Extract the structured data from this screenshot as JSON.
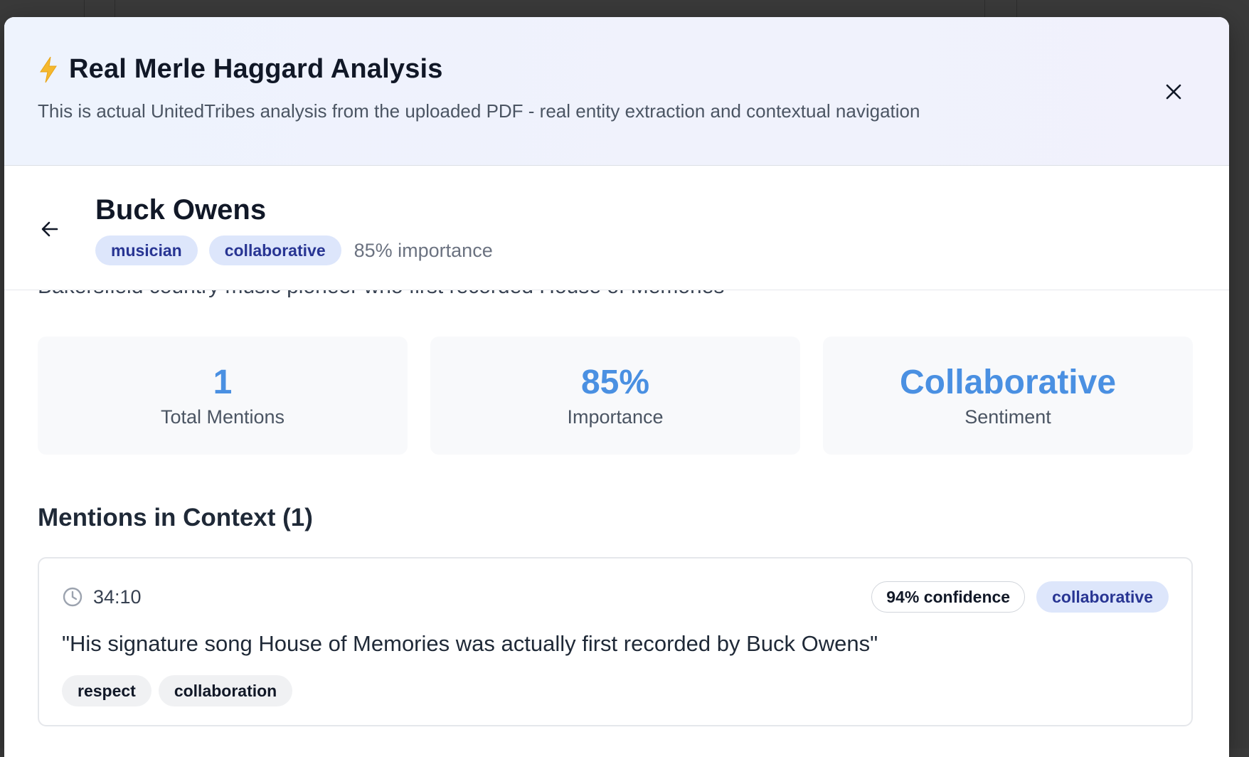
{
  "modal": {
    "title": "Real Merle Haggard Analysis",
    "subtitle": "This is actual UnitedTribes analysis from the uploaded PDF - real entity extraction and contextual navigation",
    "title_icon": "lightning-bolt-icon",
    "close_icon": "close-icon"
  },
  "entity": {
    "name": "Buck Owens",
    "type_tag": "musician",
    "sentiment_tag": "collaborative",
    "importance_text": "85% importance",
    "description": "Bakersfield country music pioneer who first recorded House of Memories",
    "back_icon": "arrow-left-icon"
  },
  "stats": [
    {
      "value": "1",
      "label": "Total Mentions"
    },
    {
      "value": "85%",
      "label": "Importance"
    },
    {
      "value": "Collaborative",
      "label": "Sentiment"
    }
  ],
  "mentions": {
    "title": "Mentions in Context (1)",
    "items": [
      {
        "timestamp": "34:10",
        "confidence": "94% confidence",
        "sentiment": "collaborative",
        "quote": "\"His signature song House of Memories was actually first recorded by Buck Owens\"",
        "keywords": [
          "respect",
          "collaboration"
        ]
      }
    ]
  },
  "colors": {
    "accent": "#4a90e2",
    "tag_bg": "#dde6fb",
    "tag_text": "#283593",
    "bolt": "#f5b82e"
  }
}
